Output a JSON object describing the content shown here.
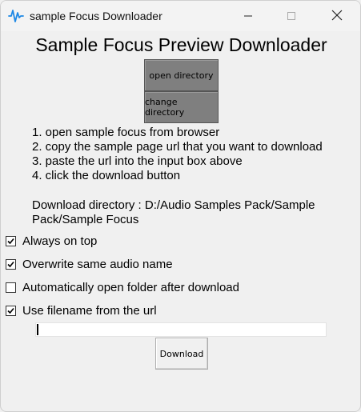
{
  "window": {
    "title": "sample Focus Downloader"
  },
  "main": {
    "heading": "Sample Focus Preview Downloader",
    "open_directory_label": "open directory",
    "change_directory_label": "change directory",
    "instructions": [
      "1. open sample focus from browser",
      "2. copy the sample page url that you want to download",
      "3. paste the url into the input box above",
      "4. click the download button"
    ],
    "download_directory_label": "Download directory : D:/Audio Samples Pack/Sample Pack/Sample Focus"
  },
  "options": [
    {
      "label": "Always on top",
      "checked": true
    },
    {
      "label": "Overwrite same audio name",
      "checked": true
    },
    {
      "label": "Automatically open folder after download",
      "checked": false
    },
    {
      "label": "Use filename from the url",
      "checked": true
    }
  ],
  "url_input": {
    "value": "",
    "placeholder": ""
  },
  "download_button_label": "Download",
  "colors": {
    "background": "#f0f0f0",
    "dark_button": "#7f7f7f",
    "app_icon": "#1e88e5"
  },
  "icons": {
    "app": "waveform-icon",
    "minimize": "minimize-icon",
    "maximize": "maximize-icon",
    "close": "close-icon"
  }
}
